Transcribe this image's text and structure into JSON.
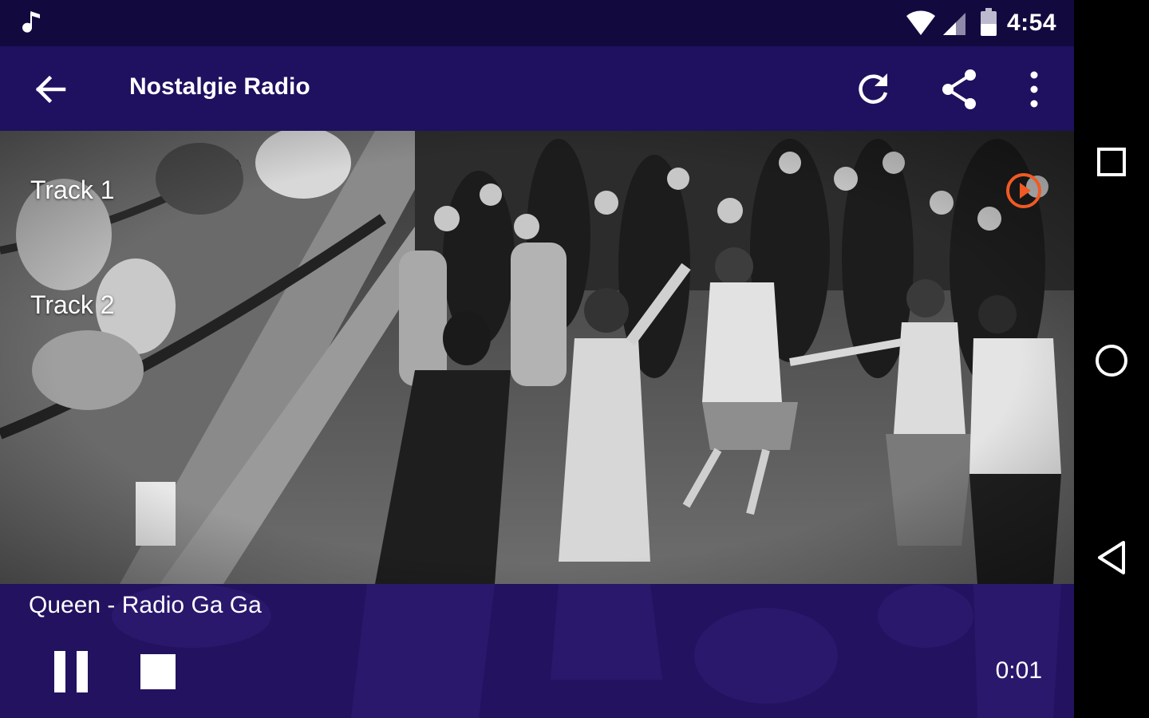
{
  "status_bar": {
    "time": "4:54",
    "icons": [
      "music-note-icon",
      "wifi-icon",
      "cell-signal-icon",
      "battery-icon"
    ]
  },
  "toolbar": {
    "title": "Nostalgie Radio",
    "icons": [
      "back-arrow-icon",
      "refresh-icon",
      "share-icon",
      "overflow-menu-icon"
    ]
  },
  "tracks": [
    {
      "label": "Track 1"
    },
    {
      "label": "Track 2"
    }
  ],
  "player": {
    "now_playing": "Queen - Radio Ga Ga",
    "elapsed": "0:01",
    "icons": [
      "pause-icon",
      "stop-icon"
    ]
  },
  "nav_bar": {
    "icons": [
      "recents-icon",
      "home-icon",
      "back-icon"
    ]
  },
  "colors": {
    "status_bar": "#120a3f",
    "toolbar": "#1f1160",
    "player": "#23125f",
    "accent_play": "#f05a24"
  }
}
